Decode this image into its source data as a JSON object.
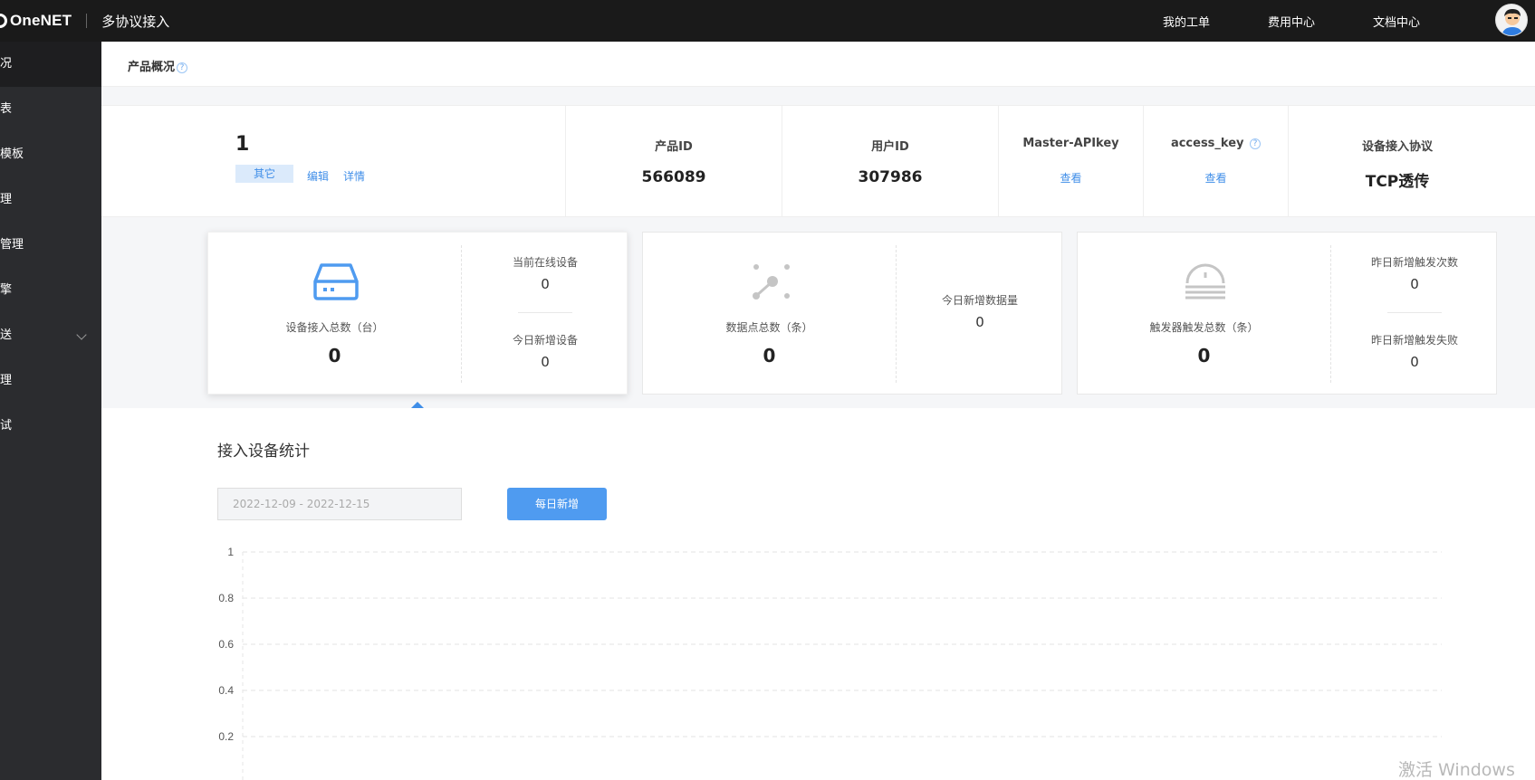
{
  "topbar": {
    "logo_text": "OneNET",
    "app_title": "多协议接入",
    "nav": [
      "我的工单",
      "费用中心",
      "文档中心"
    ]
  },
  "sidebar": {
    "items": [
      "况",
      "表",
      "模板",
      "理",
      "管理",
      "擎",
      "送",
      "理",
      "试"
    ]
  },
  "header": {
    "title": "产品概况",
    "help": "?"
  },
  "product": {
    "name": "1",
    "tag": "其它",
    "edit_link": "编辑",
    "detail_link": "详情",
    "product_id_label": "产品ID",
    "product_id": "566089",
    "user_id_label": "用户ID",
    "user_id": "307986",
    "master_key_label": "Master-APIkey",
    "master_key_link": "查看",
    "access_key_label": "access_key",
    "access_key_help": "?",
    "access_key_link": "查看",
    "protocol_label": "设备接入协议",
    "protocol": "TCP透传"
  },
  "cards": {
    "devices": {
      "label": "设备接入总数（台）",
      "total": "0",
      "online_label": "当前在线设备",
      "online": "0",
      "new_label": "今日新增设备",
      "new": "0"
    },
    "datapoints": {
      "label": "数据点总数（条）",
      "total": "0",
      "today_label": "今日新增数据量",
      "today": "0"
    },
    "triggers": {
      "label": "触发器触发总数（条）",
      "total": "0",
      "yest_count_label": "昨日新增触发次数",
      "yest_count": "0",
      "yest_fail_label": "昨日新增触发失败",
      "yest_fail": "0"
    }
  },
  "stats": {
    "title": "接入设备统计",
    "date_range": "2022-12-09 - 2022-12-15",
    "daily_button": "每日新增"
  },
  "chart_data": {
    "type": "line",
    "title": "",
    "x": [],
    "series": [],
    "yticks": [
      "1",
      "0.8",
      "0.6",
      "0.4",
      "0.2"
    ],
    "ylim": [
      0,
      1
    ],
    "grid": true
  },
  "watermark": "激活 Windows",
  "colors": {
    "accent": "#3f8ee8",
    "topbar": "#1a1a1a",
    "sidebar": "#2b2c2f",
    "button": "#4f9bf0"
  }
}
